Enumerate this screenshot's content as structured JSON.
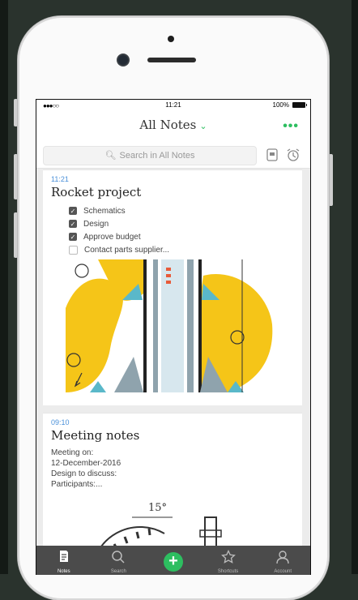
{
  "status": {
    "signal": "●●●○○",
    "time": "11:21",
    "battery": "100%"
  },
  "nav": {
    "title": "All Notes",
    "chevron": "⌄",
    "more": "•••"
  },
  "search": {
    "placeholder": "Search in All Notes",
    "icon": "search-icon"
  },
  "notes": [
    {
      "time": "11:21",
      "title": "Rocket project",
      "checklist": [
        {
          "label": "Schematics",
          "checked": true
        },
        {
          "label": "Design",
          "checked": true
        },
        {
          "label": "Approve budget",
          "checked": true
        },
        {
          "label": "Contact parts supplier...",
          "checked": false
        }
      ]
    },
    {
      "time": "09:10",
      "title": "Meeting notes",
      "body": [
        "Meeting on:",
        "12-December-2016",
        "Design to discuss:",
        "Participants:..."
      ],
      "sketch_label": "15°"
    }
  ],
  "tabs": [
    {
      "label": "Notes",
      "icon": "notes-icon",
      "active": true
    },
    {
      "label": "Search",
      "icon": "search-icon",
      "active": false
    },
    {
      "label": "",
      "icon": "plus-icon",
      "active": false
    },
    {
      "label": "Shortcuts",
      "icon": "star-icon",
      "active": false
    },
    {
      "label": "Account",
      "icon": "person-icon",
      "active": false
    }
  ],
  "colors": {
    "accent": "#2dbe60",
    "time": "#4a90d9",
    "tabbar": "#4b4b4b",
    "sketch_yellow": "#f5c518"
  }
}
